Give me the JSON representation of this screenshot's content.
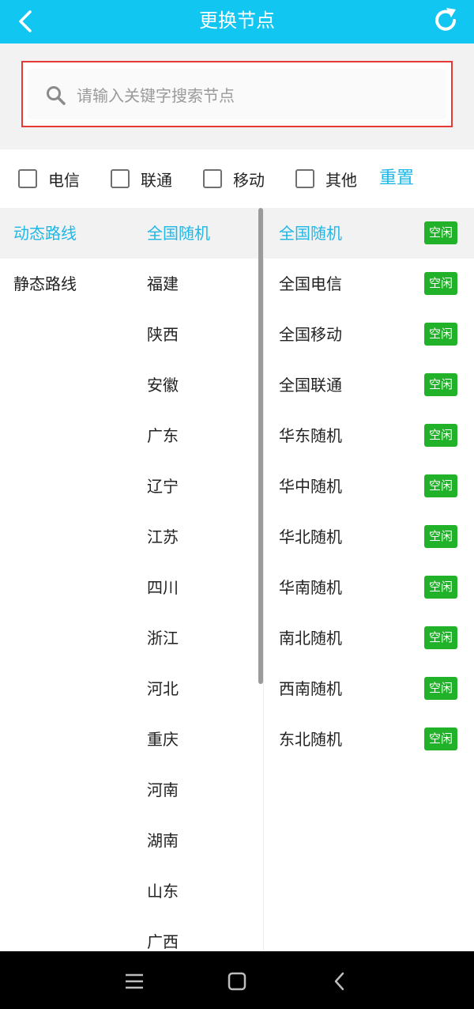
{
  "header": {
    "title": "更换节点"
  },
  "search": {
    "placeholder": "请输入关键字搜索节点",
    "value": ""
  },
  "filters": {
    "items": [
      {
        "label": "电信",
        "checked": false
      },
      {
        "label": "联通",
        "checked": false
      },
      {
        "label": "移动",
        "checked": false
      },
      {
        "label": "其他",
        "checked": false
      }
    ],
    "reset_label": "重置"
  },
  "route_types": [
    "动态路线",
    "静态路线"
  ],
  "regions": [
    "全国随机",
    "福建",
    "陕西",
    "安徽",
    "广东",
    "辽宁",
    "江苏",
    "四川",
    "浙江",
    "河北",
    "重庆",
    "河南",
    "湖南",
    "山东",
    "广西"
  ],
  "nodes": [
    {
      "name": "全国随机",
      "status": "空闲"
    },
    {
      "name": "全国电信",
      "status": "空闲"
    },
    {
      "name": "全国移动",
      "status": "空闲"
    },
    {
      "name": "全国联通",
      "status": "空闲"
    },
    {
      "name": "华东随机",
      "status": "空闲"
    },
    {
      "name": "华中随机",
      "status": "空闲"
    },
    {
      "name": "华北随机",
      "status": "空闲"
    },
    {
      "name": "华南随机",
      "status": "空闲"
    },
    {
      "name": "南北随机",
      "status": "空闲"
    },
    {
      "name": "西南随机",
      "status": "空闲"
    },
    {
      "name": "东北随机",
      "status": "空闲"
    }
  ],
  "colors": {
    "header": "#12c6f2",
    "accent": "#1fb7e6",
    "badge": "#22b229",
    "search_border": "#e53935"
  },
  "icons": {
    "back": "chevron-left-icon",
    "refresh": "refresh-icon",
    "search": "search-icon",
    "nav_menu": "menu-icon",
    "nav_home": "square-icon",
    "nav_back": "chevron-left-icon"
  }
}
